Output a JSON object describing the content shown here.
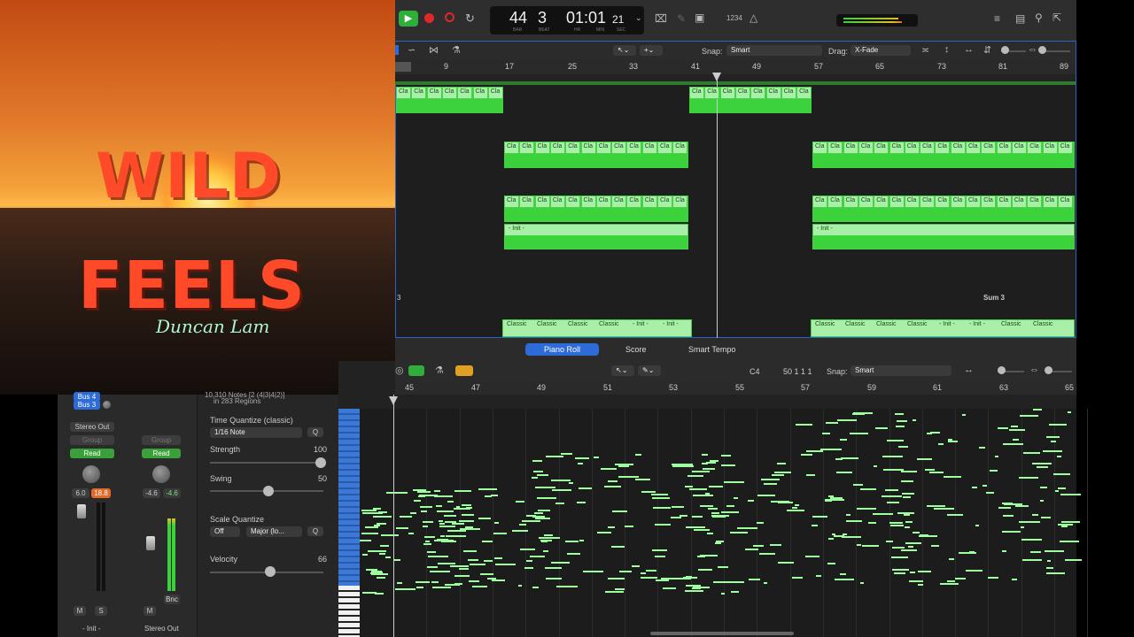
{
  "album": {
    "title_line1": "WILD",
    "title_line2": "FEELS",
    "artist": "Duncan Lam"
  },
  "mixer": {
    "ch1": {
      "bus_top": "Bus 4",
      "bus": "Bus 3",
      "output": "Stereo Out",
      "group": "Group",
      "automation": "Read",
      "pan_val": "6.0",
      "peak_val": "18.8",
      "mute": "M",
      "solo": "S",
      "name": "- Init -"
    },
    "ch2": {
      "group": "Group",
      "automation": "Read",
      "pan_val": "-4.6",
      "peak_val": "-4.6",
      "mute": "M",
      "bounce": "Bnc",
      "name": "Stereo Out"
    }
  },
  "inspector": {
    "header_line1": "10,310 Notes [2 (4|3|4|2)]",
    "header_line2": "in 283 Regions",
    "time_quantize_label": "Time Quantize (classic)",
    "time_quantize_value": "1/16 Note",
    "q_label": "Q",
    "strength_label": "Strength",
    "strength_value": "100",
    "swing_label": "Swing",
    "swing_value": "50",
    "scale_quantize_label": "Scale Quantize",
    "scale_off": "Off",
    "scale_value": "Major (lo...",
    "velocity_label": "Velocity",
    "velocity_value": "66"
  },
  "transport": {
    "bar": "44",
    "beat": "3",
    "time": "01:01",
    "frames": "21",
    "bar_lbl": "BAR",
    "beat_lbl": "BEAT",
    "hr_lbl": "HR",
    "min_lbl": "MIN",
    "sec_lbl": "SEC",
    "count": "1234"
  },
  "arrange": {
    "snap_label": "Snap:",
    "snap_value": "Smart",
    "drag_label": "Drag:",
    "drag_value": "X-Fade",
    "ruler": [
      "9",
      "17",
      "25",
      "33",
      "41",
      "49",
      "57",
      "65",
      "73",
      "81",
      "89"
    ],
    "region_label": "Cla",
    "init_label": "- Init -",
    "classic_label": "Classic",
    "sum_label": "Sum 3",
    "track_num": "3"
  },
  "editor": {
    "tabs": [
      "Piano Roll",
      "Score",
      "Smart Tempo"
    ],
    "pitch": "C4",
    "position": "50 1 1 1",
    "snap_label": "Snap:",
    "snap_value": "Smart",
    "ruler": [
      "45",
      "47",
      "49",
      "51",
      "53",
      "55",
      "57",
      "59",
      "61",
      "63",
      "65"
    ]
  },
  "colors": {
    "accent": "#2c6bd8",
    "region_green": "#3bd23b",
    "note_green": "#9dff9d",
    "title_red": "#ff4a2a"
  }
}
